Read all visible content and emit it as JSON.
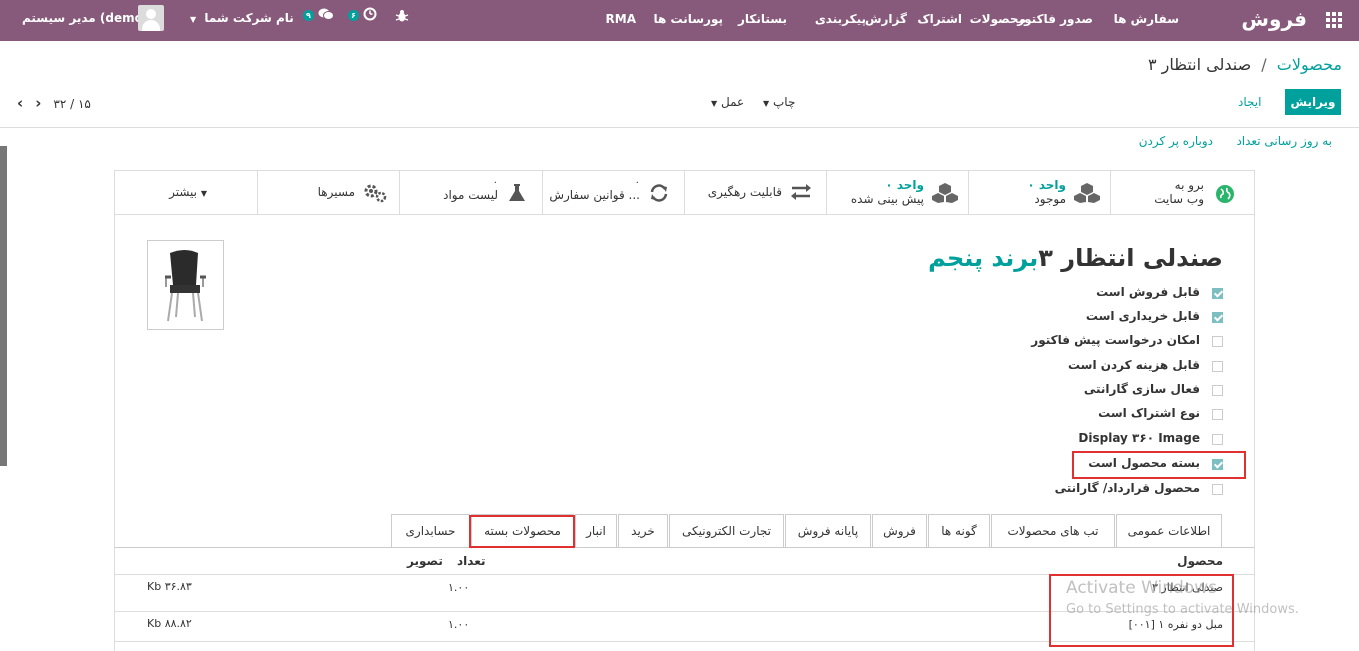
{
  "nav": {
    "brand": "فروش",
    "menu": [
      "سفارش ها",
      "صدور فاکتور",
      "محصولات",
      "اشتراک",
      "گزارش",
      "پیکربندی",
      "بستانکار",
      "پورسانت ها",
      "RMA"
    ],
    "company": "نام شرکت شما",
    "user": "مدیر سیستم (demo)",
    "messages_count": "۹",
    "activities_count": "۶",
    "icons": [
      "apps-grid-icon",
      "chat-icon",
      "clock-icon",
      "bug-icon",
      "chevron-down-icon",
      "avatar-icon"
    ]
  },
  "breadcrumb": {
    "parent": "محصولات",
    "separator": "/",
    "current": "صندلی انتظار ۳"
  },
  "buttons": {
    "edit": "ویرایش",
    "create": "ایجاد",
    "print": "چاپ",
    "action": "عمل"
  },
  "pager": {
    "value": "۳۲ / ۱۵"
  },
  "status_actions": {
    "update_qty": "به روز رسانی تعداد",
    "replenish": "دوباره پر کردن"
  },
  "smart_buttons": {
    "website_line1": "برو به",
    "website_line2": "وب سایت",
    "onhand_value": "۰ واحد",
    "onhand_label": "موجود",
    "forecast_value": "۰ واحد",
    "forecast_label": "پیش بینی شده",
    "traceability": "قابلیت رهگیری",
    "reorder_value": "۰",
    "reorder_label": "قوانین سفارش ...",
    "bom_value": "۰",
    "bom_label": "لیست مواد",
    "routes": "مسیرها",
    "more": "بیشتر"
  },
  "product": {
    "name_part1": "صندلی انتظار ۳",
    "name_part2": "برند پنجم"
  },
  "flags": [
    {
      "label": "قابل فروش است",
      "checked": true
    },
    {
      "label": "قابل خریداری است",
      "checked": true
    },
    {
      "label": "امکان درخواست پیش فاکتور",
      "checked": false
    },
    {
      "label": "قابل هزینه کردن است",
      "checked": false
    },
    {
      "label": "فعال سازی گارانتی",
      "checked": false
    },
    {
      "label": "نوع اشتراک است",
      "checked": false
    },
    {
      "label": "Display ۳۶۰ Image",
      "checked": false
    },
    {
      "label": "بسته محصول است",
      "checked": true
    },
    {
      "label": "محصول قرارداد/ گارانتی",
      "checked": false
    }
  ],
  "tabs": [
    "اطلاعات عمومی",
    "تب های محصولات",
    "گونه ها",
    "فروش",
    "پایانه فروش",
    "تجارت الکترونیکی",
    "خرید",
    "انبار",
    "محصولات بسته",
    "حسابداری"
  ],
  "table": {
    "headers": {
      "product": "محصول",
      "qty": "تعداد",
      "image": "تصویر"
    },
    "rows": [
      {
        "product": "صندلی انتظار ۳",
        "qty": "۱.۰۰",
        "image": "Kb ۳۶.۸۳"
      },
      {
        "product": "[۰۰۱] مبل دو نفره ۱",
        "qty": "۱.۰۰",
        "image": "Kb ۸۸.۸۲"
      }
    ]
  },
  "watermark": {
    "line1": "Activate Windows",
    "line2": "Go to Settings to activate Windows."
  },
  "colors": {
    "nav": "#875a7b",
    "accent": "#00a09d",
    "highlight": "#e03030"
  }
}
